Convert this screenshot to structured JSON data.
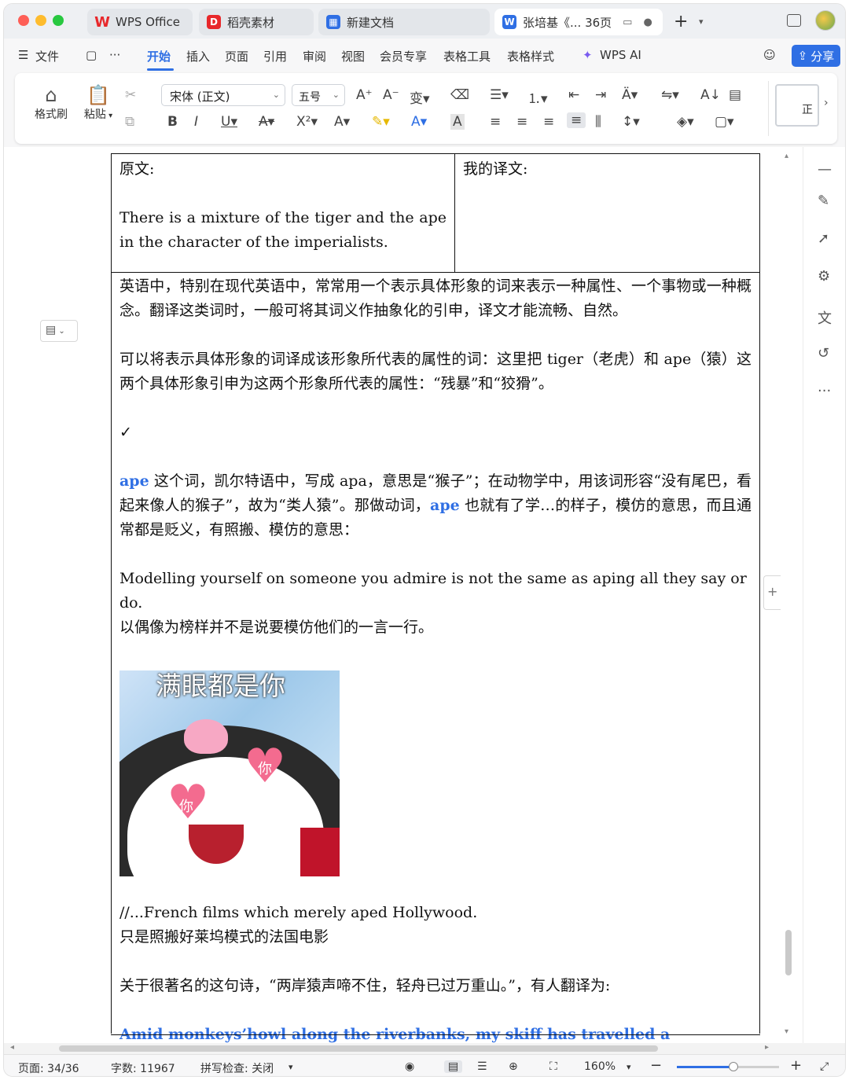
{
  "tabs": [
    {
      "label": "WPS Office"
    },
    {
      "label": "稻壳素材"
    },
    {
      "label": "新建文档"
    },
    {
      "label": "张培基《... 36页",
      "active": true
    }
  ],
  "menu": {
    "file": "文件",
    "items": [
      "开始",
      "插入",
      "页面",
      "引用",
      "审阅",
      "视图",
      "会员专享",
      "表格工具",
      "表格样式",
      "WPS AI"
    ],
    "active": "开始",
    "share": "分享"
  },
  "ribbon": {
    "format_painter": "格式刷",
    "paste": "粘贴",
    "font_name": "宋体 (正文)",
    "font_size": "五号",
    "style_preview": "正"
  },
  "doc": {
    "cell_source_label": "原文:",
    "cell_source_text": "There is a mixture of the tiger and the ape in the character of the imperialists.",
    "cell_translation_label": "我的译文:",
    "p1": "英语中，特别在现代英语中，常常用一个表示具体形象的词来表示一种属性、一个事物或一种概念。翻译这类词时，一般可将其词义作抽象化的引申，译文才能流畅、自然。",
    "p2": "可以将表示具体形象的词译成该形象所代表的属性的词：这里把 tiger（老虎）和 ape（猿）这两个具体形象引申为这两个形象所代表的属性：“残暴”和“狡猾”。",
    "check": "✓",
    "p3_kw1": "ape",
    "p3_a": " 这个词，凯尔特语中，写成 apa，意思是“猴子”；在动物学中，用该词形容“没有尾巴，看起来像人的猴子”，故为“类人猿”。那做动词，",
    "p3_kw2": "ape",
    "p3_b": " 也就有了学…的样子，模仿的意思，而且通常都是贬义，有照搬、模仿的意思：",
    "ex1_en": "Modelling yourself on someone you admire is not the same as aping all they say or do.",
    "ex1_zh": "以偶像为榜样并不是说要模仿他们的一言一行。",
    "sticker_caption": "满眼都是你",
    "sticker_heart_text": "你",
    "ex2_en": "//...French films which merely aped Hollywood.",
    "ex2_zh": "只是照搬好莱坞模式的法国电影",
    "p4": "关于很著名的这句诗，“两岸猿声啼不住，轻舟已过万重山。”，有人翻译为:",
    "quote_en": "Amid monkeys’howl along the riverbanks, my skiff has travelled a thousand miles."
  },
  "status": {
    "page": "页面: 34/36",
    "words": "字数: 11967",
    "spell": "拼写检查: 关闭",
    "zoom": "160%",
    "zoom_level": 0.55
  },
  "colors": {
    "accent": "#2f6fe4",
    "wps_red": "#e8282b"
  }
}
